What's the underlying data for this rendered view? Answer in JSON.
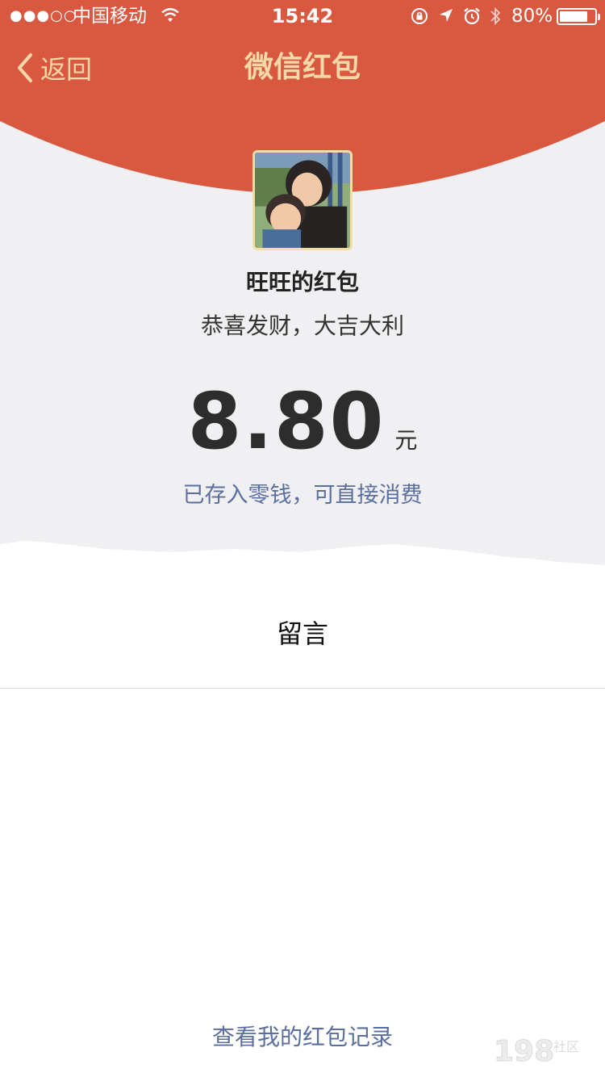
{
  "status_bar": {
    "signal": "●●●○○",
    "carrier": "中国移动",
    "time": "15:42",
    "battery_percent": "80%",
    "battery_level": 0.8,
    "icons": [
      "wifi-icon",
      "rotation-lock-icon",
      "location-icon",
      "alarm-icon",
      "bluetooth-icon",
      "battery-icon"
    ]
  },
  "nav": {
    "back_label": "返回",
    "title": "微信红包"
  },
  "colors": {
    "header_red": "#d95940",
    "title_gold": "#f5d8a8",
    "link_blue": "#5b6f9e",
    "background_gray": "#f0eff2"
  },
  "packet": {
    "sender": "旺旺的红包",
    "greeting": "恭喜发财，大吉大利",
    "amount": "8.80",
    "currency": "元",
    "saved_note": "已存入零钱，可直接消费"
  },
  "message_section": {
    "label": "留言"
  },
  "footer": {
    "records_link": "查看我的红包记录"
  },
  "watermark": {
    "text": "198社区"
  }
}
